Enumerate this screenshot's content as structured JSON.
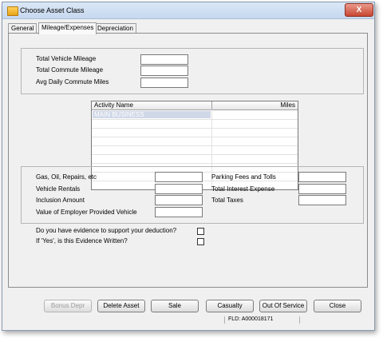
{
  "window": {
    "title": "Choose Asset Class",
    "close_glyph": "X"
  },
  "tabs": [
    {
      "label": "General"
    },
    {
      "label": "Mileage/Expenses"
    },
    {
      "label": "Depreciation"
    }
  ],
  "mileage": {
    "total_vehicle_mileage": {
      "label": "Total Vehicle Mileage",
      "value": ""
    },
    "total_commute_mileage": {
      "label": "Total Commute Mileage",
      "value": ""
    },
    "avg_daily_commute": {
      "label": "Avg Daily Commute Miles",
      "value": ""
    }
  },
  "activity_grid": {
    "columns": [
      "Activity Name",
      "Miles"
    ],
    "rows": [
      {
        "activity": "MAIN BUSINESS",
        "miles": ""
      }
    ]
  },
  "expenses": {
    "gas_oil": {
      "label": "Gas, Oil, Repairs, etc",
      "value": ""
    },
    "vehicle_rentals": {
      "label": "Vehicle Rentals",
      "value": ""
    },
    "inclusion_amount": {
      "label": "Inclusion Amount",
      "value": ""
    },
    "employer_vehicle": {
      "label": "Value of Employer Provided Vehicle",
      "value": ""
    },
    "parking_fees": {
      "label": "Parking Fees and Tolls",
      "value": ""
    },
    "total_interest": {
      "label": "Total Interest Expense",
      "value": ""
    },
    "total_taxes": {
      "label": "Total Taxes",
      "value": ""
    }
  },
  "evidence": {
    "q1": {
      "label": "Do you have evidence to support your deduction?",
      "checked": false
    },
    "q2": {
      "label": "If 'Yes', is this Evidence Written?",
      "checked": false
    }
  },
  "buttons": {
    "bonus_depr": "Bonus Depr",
    "delete_asset": "Delete Asset",
    "sale": "Sale",
    "casualty": "Casualty",
    "out_of_service": "Out Of Service",
    "close": "Close"
  },
  "status": {
    "fld": "FLD: A000018171"
  }
}
